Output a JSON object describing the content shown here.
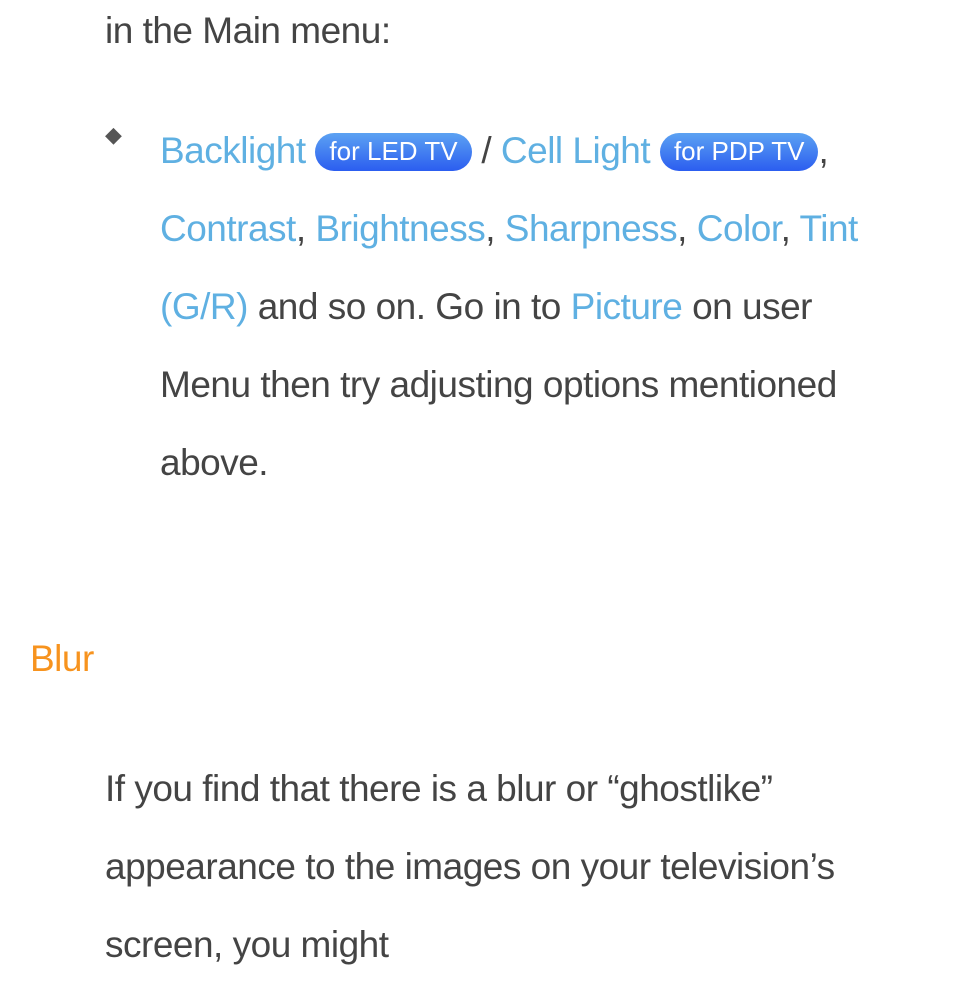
{
  "intro": "in the Main menu:",
  "bullet": {
    "marker": "◆",
    "backlight": "Backlight",
    "pill_led": "for LED TV",
    "sep1": " / ",
    "cell_light": "Cell Light",
    "pill_pdp": "for PDP TV",
    "sep2": ", ",
    "contrast": "Contrast",
    "brightness": "Brightness",
    "sharpness": "Sharpness",
    "color": "Color",
    "tint": "Tint (G/R)",
    "tail1": " and so on. Go in to ",
    "picture": "Picture",
    "tail2": " on user Menu then try adjusting options mentioned above."
  },
  "heading": "Blur",
  "paragraph": "If you find that there is a blur or “ghostlike” appearance to the images on your television’s screen, you might"
}
